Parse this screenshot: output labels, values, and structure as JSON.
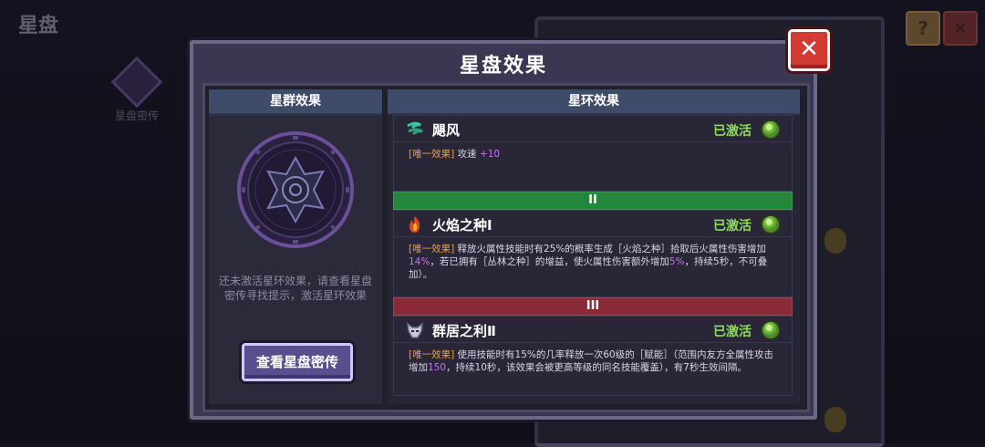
{
  "background": {
    "title": "星盘",
    "icon_label": "星盘密传",
    "help_button": "?",
    "close_button": "✕"
  },
  "modal": {
    "title": "星盘效果",
    "close_label": "✕",
    "left_panel": {
      "header": "星群效果",
      "hint": "还未激活星环效果，请查看星盘密传寻找提示，激活星环效果",
      "button_label": "查看星盘密传"
    },
    "right_panel": {
      "header": "星环效果",
      "effects": [
        {
          "icon": "wind-icon",
          "name": "飓风",
          "status": "已激活",
          "tag": "[唯一效果]",
          "desc_parts": [
            " 攻速 ",
            "+10",
            ""
          ]
        },
        {
          "tier": "II",
          "icon": "flame-seed-icon",
          "name": "火焰之种Ⅰ",
          "status": "已激活",
          "tag": "[唯一效果]",
          "desc_parts": [
            " 释放火属性技能时有25%的概率生成［火焰之种］拾取后火属性伤害增加",
            "14%",
            "，若已拥有［丛林之种］的增益，使火属性伤害额外增加",
            "5%",
            "，持续5秒，不可叠加）。"
          ]
        },
        {
          "tier": "III",
          "icon": "wolf-icon",
          "name": "群居之利Ⅱ",
          "status": "已激活",
          "tag": "[唯一效果]",
          "desc_parts": [
            " 使用技能时有15%的几率释放一次60级的［赋能］（范围内友方全属性攻击增加",
            "150",
            "，持续10秒，该效果会被更高等级的同名技能覆盖），有7秒生效间隔。"
          ]
        }
      ]
    }
  },
  "colors": {
    "accent_green": "#8edc5a",
    "tag_orange": "#f0a23c",
    "number_purple": "#c774f0",
    "tier_green": "#24863a",
    "tier_red": "#8a2a36"
  }
}
